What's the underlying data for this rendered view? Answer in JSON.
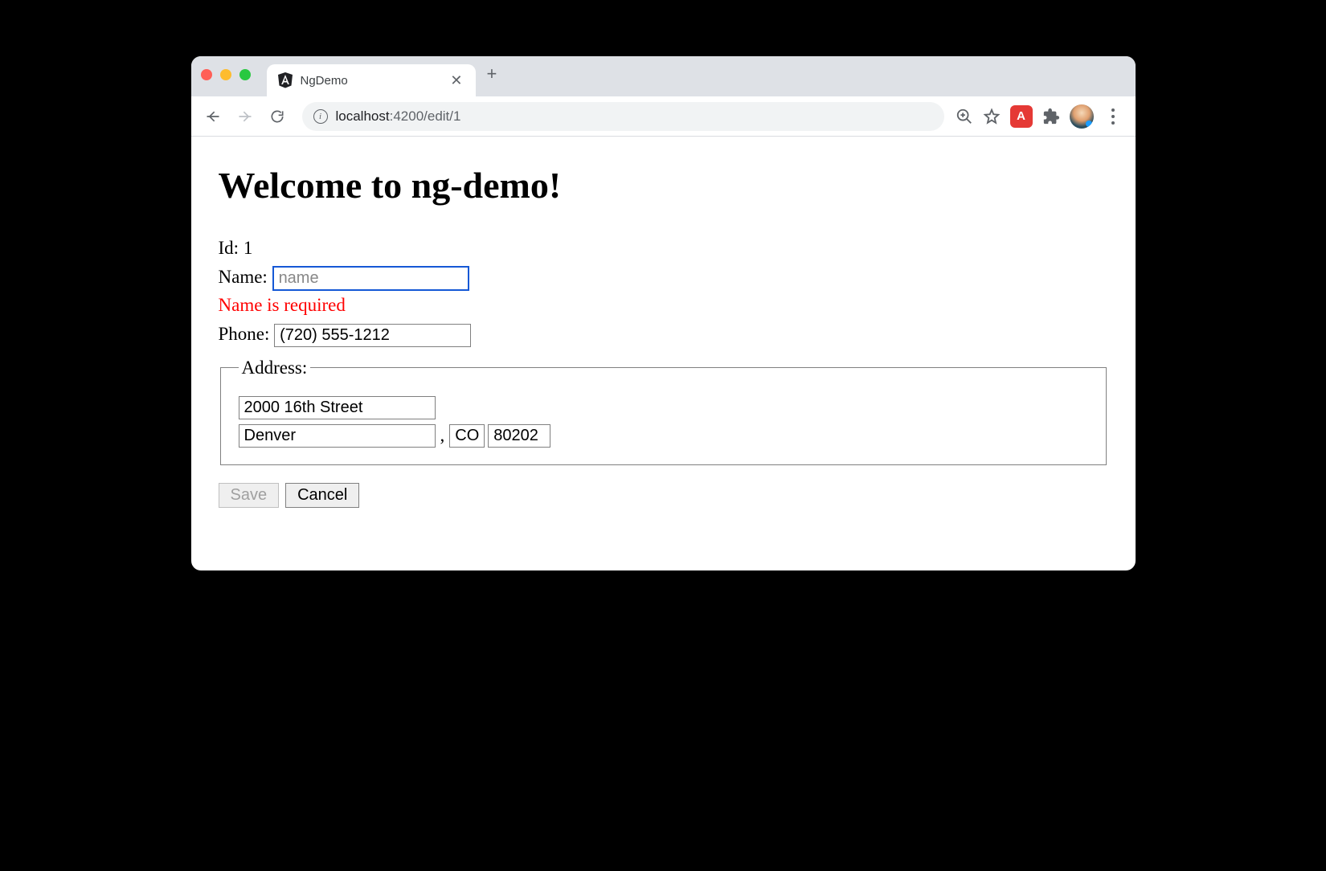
{
  "browser": {
    "tab_title": "NgDemo",
    "url_host": "localhost",
    "url_port_path": ":4200/edit/1"
  },
  "page": {
    "heading": "Welcome to ng-demo!",
    "id_label": "Id:",
    "id_value": "1",
    "name_label": "Name:",
    "name_value": "",
    "name_placeholder": "name",
    "name_error": "Name is required",
    "phone_label": "Phone:",
    "phone_value": "(720) 555-1212",
    "address_legend": "Address:",
    "street_value": "2000 16th Street",
    "city_value": "Denver",
    "comma": ",",
    "state_value": "CO",
    "zip_value": "80202",
    "save_label": "Save",
    "cancel_label": "Cancel"
  }
}
